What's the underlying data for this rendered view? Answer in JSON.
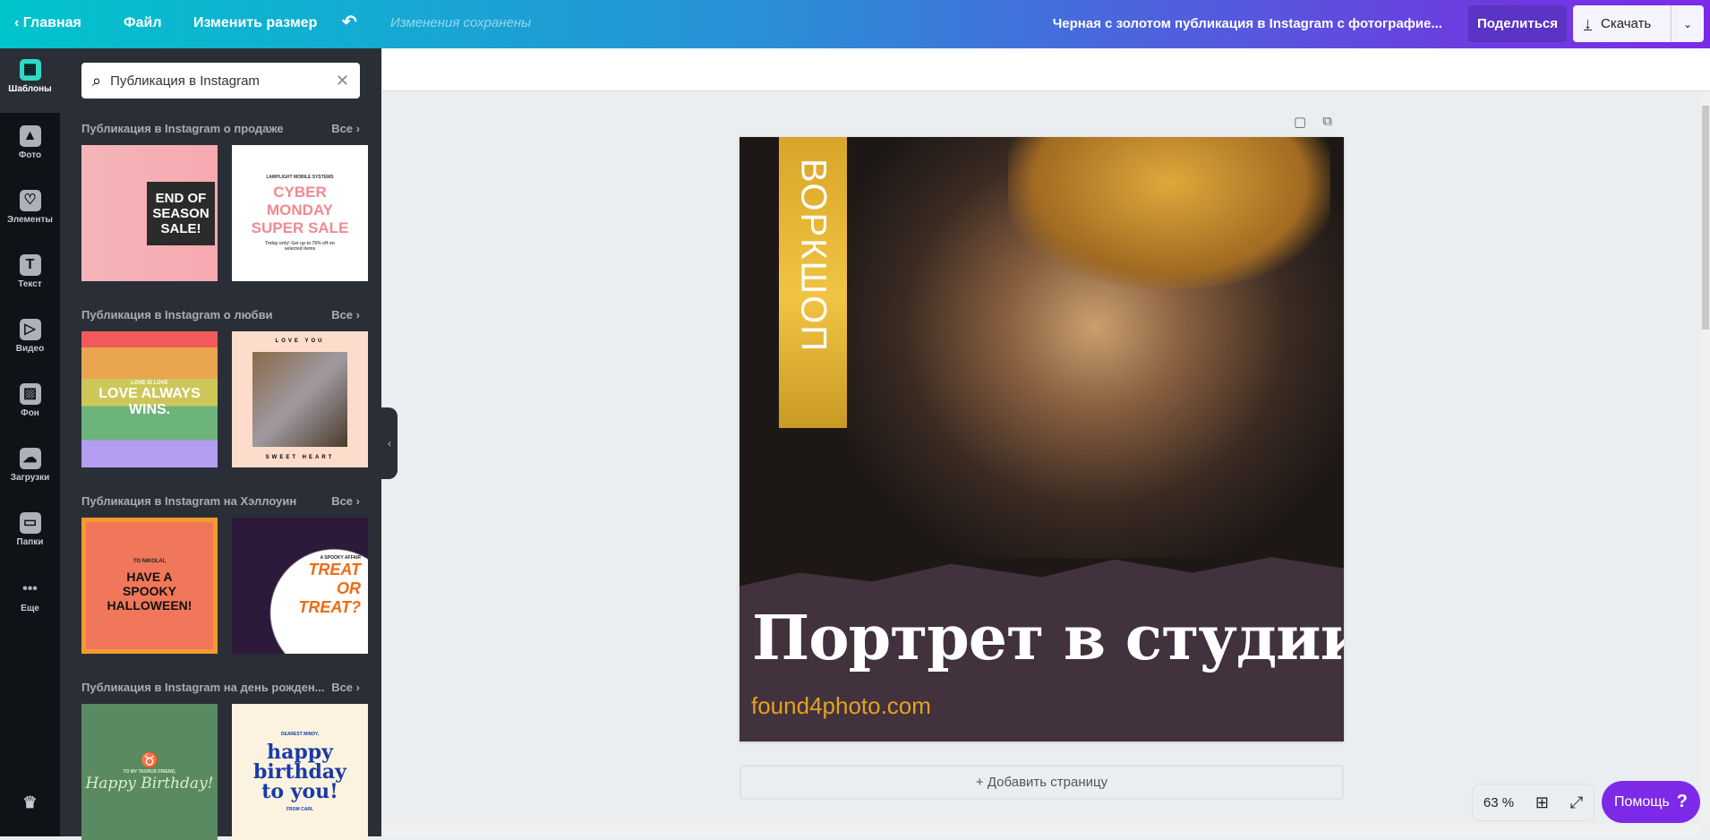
{
  "header": {
    "home": "Главная",
    "file": "Файл",
    "resize": "Изменить размер",
    "saved_status": "Изменения сохранены",
    "doc_title": "Черная с золотом публикация в Instagram с фотографие...",
    "share": "Поделиться",
    "download": "Скачать"
  },
  "rail": [
    {
      "label": "Шаблоны",
      "icon": "templates-icon"
    },
    {
      "label": "Фото",
      "icon": "photo-icon"
    },
    {
      "label": "Элементы",
      "icon": "elements-icon"
    },
    {
      "label": "Текст",
      "icon": "text-icon"
    },
    {
      "label": "Видео",
      "icon": "video-icon"
    },
    {
      "label": "Фон",
      "icon": "background-icon"
    },
    {
      "label": "Загрузки",
      "icon": "upload-icon"
    },
    {
      "label": "Папки",
      "icon": "folder-icon"
    },
    {
      "label": "Еще",
      "icon": "more-icon"
    }
  ],
  "search": {
    "value": "Публикация в Instagram"
  },
  "sections": [
    {
      "title": "Публикация в Instagram о продаже",
      "all": "Все",
      "thumbs": [
        {
          "text": "END OF SEASON SALE!"
        },
        {
          "top": "LAMPLIGHT MOBILE SYSTEMS",
          "text": "CYBER MONDAY SUPER SALE",
          "bottom": "Today only! Get up to 75% off on selected items"
        }
      ]
    },
    {
      "title": "Публикация в Instagram о любви",
      "all": "Все",
      "thumbs": [
        {
          "top": "LOVE IS LOVE",
          "text": "LOVE ALWAYS WINS."
        },
        {
          "top": "LOVE YOU",
          "text": "",
          "bottom": "SWEET HEART"
        }
      ]
    },
    {
      "title": "Публикация в Instagram на Хэллоуин",
      "all": "Все",
      "thumbs": [
        {
          "top": "TO NIKOLAI,",
          "text": "HAVE A SPOOKY HALLOWEEN!"
        },
        {
          "top": "A SPOOKY AFFAIR",
          "text": "TREAT OR TREAT?"
        }
      ]
    },
    {
      "title": "Публикация в Instagram на день рожден...",
      "all": "Все",
      "thumbs": [
        {
          "top": "TO MY TAURUS FRIEND,",
          "text": "Happy Birthday!"
        },
        {
          "top": "DEAREST MINDY,",
          "text": "happy birthday to you!",
          "bottom": "FROM CARL"
        }
      ]
    }
  ],
  "design": {
    "band_text": "ВОРКШОП",
    "title": "Портрет в студии",
    "url": "found4photo.com",
    "gold": "#e3a221",
    "bg": "#41323d"
  },
  "canvas": {
    "add_page": "+ Добавить страницу",
    "zoom": "63 %",
    "help": "Помощь",
    "help_icon": "?"
  }
}
